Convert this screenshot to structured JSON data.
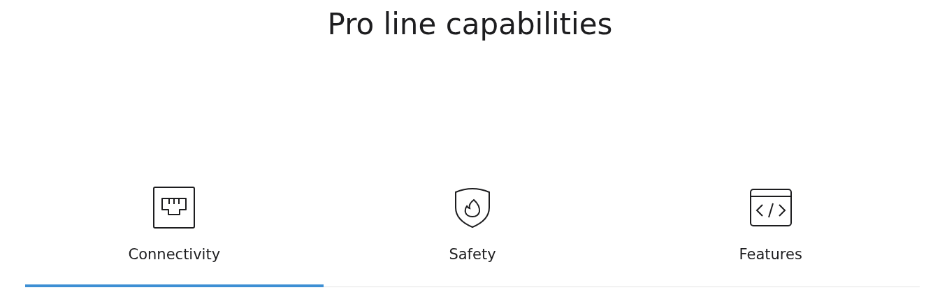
{
  "title": "Pro line capabilities",
  "tabs": [
    {
      "label": "Connectivity",
      "kind": "ethernet",
      "selected": true
    },
    {
      "label": "Safety",
      "kind": "shield",
      "selected": false
    },
    {
      "label": "Features",
      "kind": "code",
      "selected": false
    }
  ]
}
